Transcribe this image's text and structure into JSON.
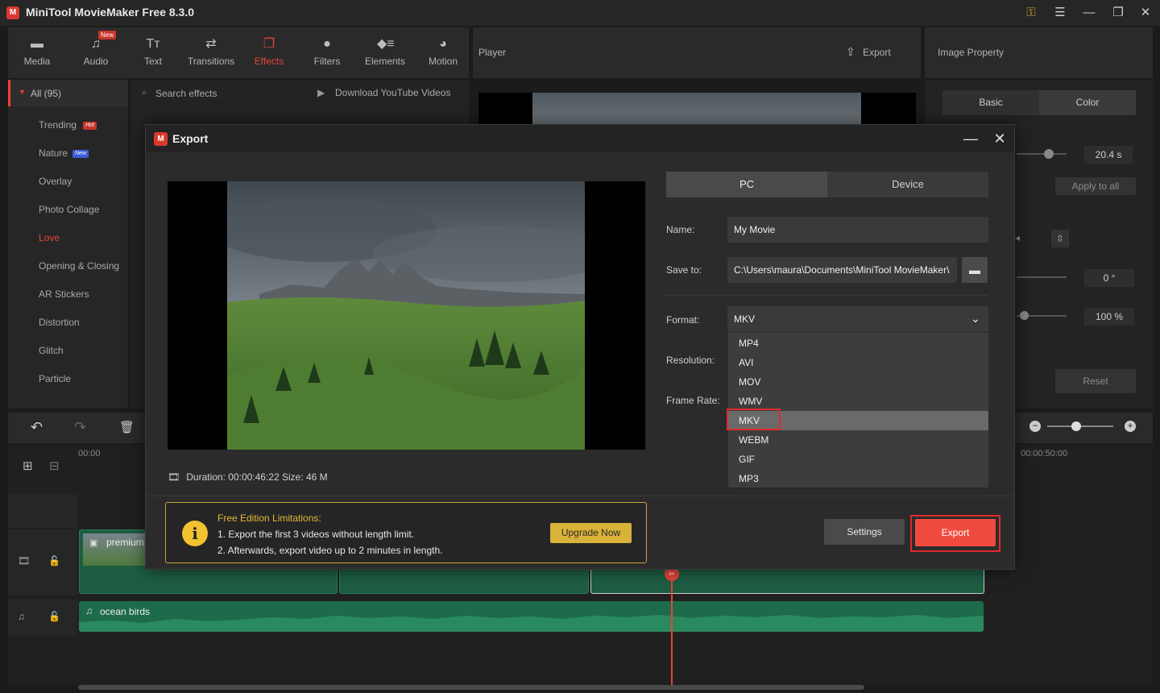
{
  "app": {
    "title": "MiniTool MovieMaker Free 8.3.0",
    "logo_text": "M"
  },
  "toolbar": {
    "new_badge": "New",
    "items": [
      {
        "label": "Media",
        "icon": "folder-icon"
      },
      {
        "label": "Audio",
        "icon": "music-note-icon"
      },
      {
        "label": "Text",
        "icon": "text-icon"
      },
      {
        "label": "Transitions",
        "icon": "swap-arrows-icon"
      },
      {
        "label": "Effects",
        "icon": "effects-icon"
      },
      {
        "label": "Filters",
        "icon": "filters-icon"
      },
      {
        "label": "Elements",
        "icon": "elements-icon"
      },
      {
        "label": "Motion",
        "icon": "motion-icon"
      }
    ],
    "active": "Effects"
  },
  "player": {
    "label": "Player",
    "export_label": "Export"
  },
  "image_property": {
    "label": "Image Property",
    "tabs": [
      "Basic",
      "Color"
    ],
    "duration": "20.4 s",
    "apply_all": "Apply to all",
    "rotation": "0 °",
    "scale": "100 %",
    "reset": "Reset"
  },
  "categories": {
    "all": "All (95)",
    "items": [
      "Trending",
      "Nature",
      "Overlay",
      "Photo Collage",
      "Love",
      "Opening & Closing",
      "AR Stickers",
      "Distortion",
      "Glitch",
      "Particle"
    ],
    "hot_badge": "Hot",
    "new_badge": "New"
  },
  "effects_bar": {
    "search_placeholder": "Search effects",
    "download": "Download YouTube Videos"
  },
  "timeline": {
    "time_start": "00:00",
    "time_end": "00:00:50:00",
    "video_clip": "premium",
    "audio_clip": "ocean birds"
  },
  "dialog": {
    "title": "Export",
    "tabs": [
      "PC",
      "Device"
    ],
    "active_tab": "PC",
    "name_label": "Name:",
    "name_value": "My Movie",
    "save_label": "Save to:",
    "save_value": "C:\\Users\\maura\\Documents\\MiniTool MovieMaker\\",
    "format_label": "Format:",
    "format_value": "MKV",
    "resolution_label": "Resolution:",
    "framerate_label": "Frame Rate:",
    "format_options": [
      "MP4",
      "AVI",
      "MOV",
      "WMV",
      "MKV",
      "WEBM",
      "GIF",
      "MP3"
    ],
    "selected_format": "MKV",
    "duration_text": "Duration:  00:00:46:22  Size:  46 M",
    "limits": {
      "title": "Free Edition Limitations:",
      "line1": "1. Export the first 3 videos without length limit.",
      "line2": "2. Afterwards, export video up to 2 minutes in length.",
      "upgrade": "Upgrade Now"
    },
    "settings": "Settings",
    "export": "Export"
  },
  "colors": {
    "accent": "#ef4a3f",
    "highlight_box": "#e02b2b",
    "upgrade": "#d9b23a",
    "clip_green": "#1d6b4a"
  }
}
